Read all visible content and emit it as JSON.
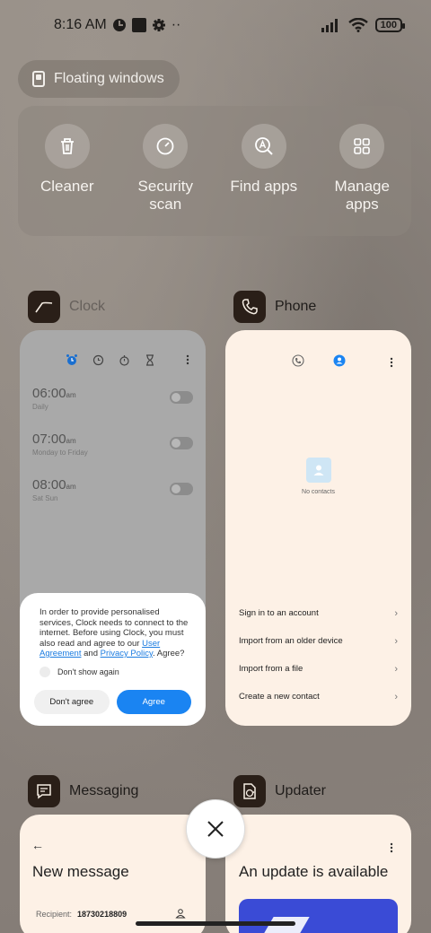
{
  "status_bar": {
    "time": "8:16 AM",
    "battery": "100"
  },
  "floating_windows": {
    "label": "Floating windows"
  },
  "tools": [
    {
      "label": "Cleaner",
      "icon": "trash-icon"
    },
    {
      "label": "Security scan",
      "icon": "shield-scan-icon"
    },
    {
      "label": "Find apps",
      "icon": "search-app-icon"
    },
    {
      "label": "Manage apps",
      "icon": "grid-icon"
    }
  ],
  "apps": {
    "clock": {
      "name": "Clock",
      "alarms": [
        {
          "time": "06:00",
          "ampm": "am",
          "sub": "Daily"
        },
        {
          "time": "07:00",
          "ampm": "am",
          "sub": "Monday to Friday"
        },
        {
          "time": "08:00",
          "ampm": "am",
          "sub": "Sat Sun"
        }
      ],
      "dialog": {
        "text_1": "In order to provide personalised services, Clock needs to connect to the internet. Before using Clock, you must also read and agree to our ",
        "link_user": "User Agreement",
        "and": " and ",
        "link_privacy": "Privacy Policy",
        "text_end": ". Agree?",
        "dont_show": "Don't show again",
        "dont_agree": "Don't agree",
        "agree": "Agree"
      }
    },
    "phone": {
      "name": "Phone",
      "no_contacts": "No contacts",
      "options": [
        "Sign in to an account",
        "Import from an older device",
        "Import from a file",
        "Create a new contact"
      ]
    },
    "messaging": {
      "name": "Messaging",
      "title": "New message",
      "recipient_label": "Recipient:",
      "recipient_value": "18730218809"
    },
    "updater": {
      "name": "Updater",
      "title": "An update is available"
    }
  },
  "colors": {
    "accent": "#1a84f2",
    "card_bg": "#fdf1e6"
  }
}
